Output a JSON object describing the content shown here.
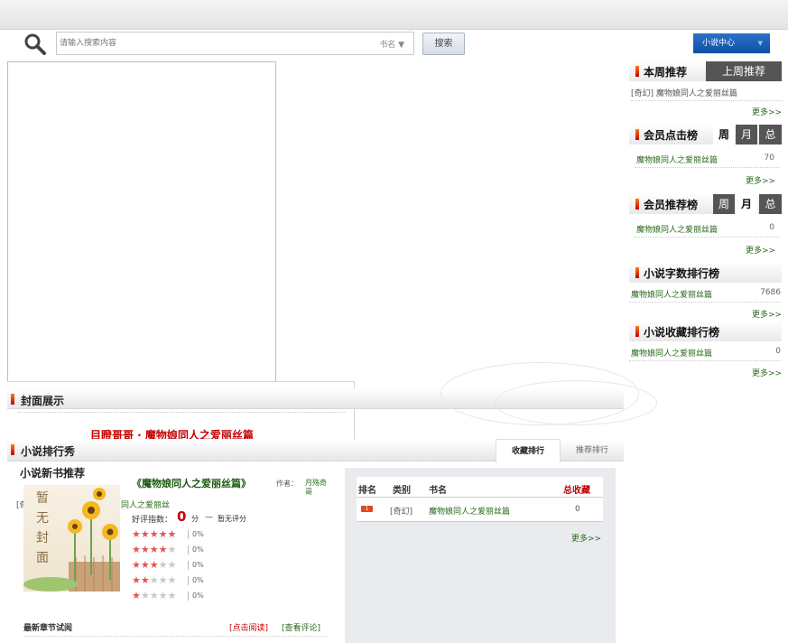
{
  "search": {
    "placeholder": "请输入搜索内容",
    "type_label": "书名 ▼",
    "button_label": "搜索"
  },
  "user_center": {
    "label": "小说中心",
    "caret": "▼"
  },
  "sidebar": {
    "weekly_recommend": {
      "title": "本周推荐",
      "tab_last_week": "上周推荐",
      "item": "[奇幻] 魔物娘同人之爱丽丝篇",
      "more": "更多>>"
    },
    "member_clicks": {
      "title": "会员点击榜",
      "tabs": [
        "周",
        "月",
        "总"
      ],
      "item_name": "魔物娘同人之爱丽丝篇",
      "item_value": "70",
      "more": "更多>>"
    },
    "member_recommend": {
      "title": "会员推荐榜",
      "tabs": [
        "周",
        "月",
        "总"
      ],
      "item_name": "魔物娘同人之爱丽丝篇",
      "item_value": "0",
      "more": "更多>>"
    },
    "word_count": {
      "title": "小说字数排行榜",
      "item_name": "魔物娘同人之爱丽丝篇",
      "item_value": "7686",
      "more": "更多>>"
    },
    "favorites": {
      "title": "小说收藏排行榜",
      "item_name": "魔物娘同人之爱丽丝篇",
      "item_value": "0",
      "more": "更多>>"
    }
  },
  "cover_display": {
    "title": "封面展示",
    "marquee": "目瞪哥哥 · 魔物娘同人之爱丽丝篇"
  },
  "novel_ranking": {
    "title": "小说排行秀",
    "tab_active": "收藏排行",
    "tab_other": "推荐排行",
    "table": {
      "headers": [
        "排名",
        "类别",
        "书名",
        "总收藏"
      ],
      "rows": [
        {
          "rank": "1",
          "category": "[奇幻]",
          "name": "魔物娘同人之爱丽丝篇",
          "total": "0"
        }
      ]
    },
    "more": "更多>>"
  },
  "new_book": {
    "title": "小说新书推荐",
    "side_fragment_1": "[奇",
    "side_fragment_2": "同人之爱丽丝",
    "book_title": "《魔物娘同人之爱丽丝篇》",
    "author_label": "作者：",
    "author": "月殇奇哥",
    "score_label": "好评指数：",
    "score_value": "0",
    "score_unit": "分",
    "score_dash": "—",
    "score_note": "暂无评分",
    "cover_placeholder": [
      "暂",
      "无",
      "封",
      "面"
    ],
    "ratings": [
      {
        "stars": 5,
        "pct": "0%"
      },
      {
        "stars": 4,
        "pct": "0%"
      },
      {
        "stars": 3,
        "pct": "0%"
      },
      {
        "stars": 2,
        "pct": "0%"
      },
      {
        "stars": 1,
        "pct": "0%"
      }
    ],
    "latest_chapter_label": "最新章节试阅",
    "read_link": "[点击阅读]",
    "comment_link": "[查看评论]"
  },
  "colors": {
    "accent_red": "#c40000",
    "link_green": "#2a6a1c",
    "user_center_blue": "#1a5cb0",
    "tab_dark": "#555555"
  }
}
